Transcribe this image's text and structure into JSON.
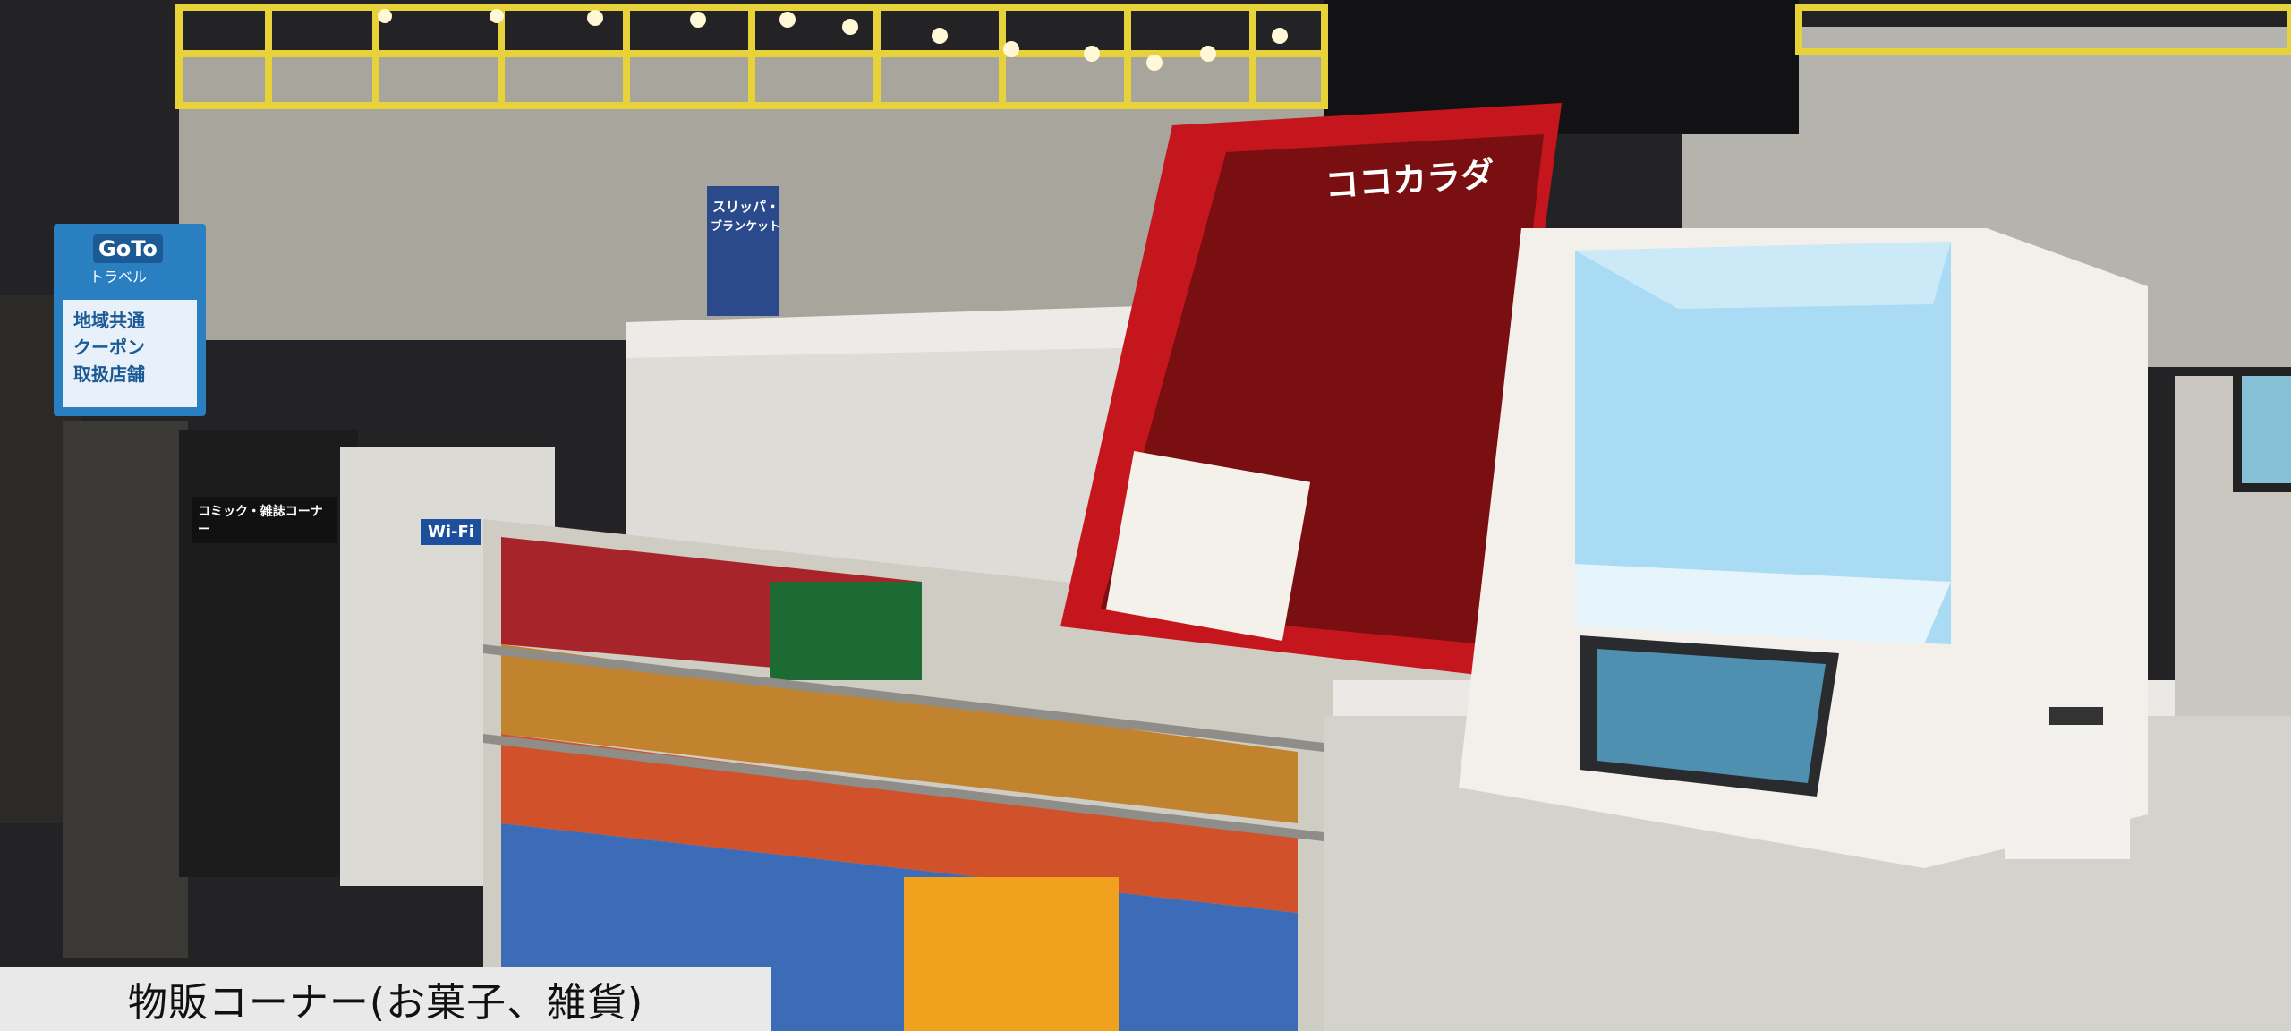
{
  "caption": "物販コーナー(お菓子、雑貨)",
  "signs": {
    "goto_logo": "GoTo",
    "goto_sub": "トラベル",
    "goto_line1": "地域共通",
    "goto_line2": "クーポン",
    "goto_line3": "取扱店舗",
    "slipper_line1": "スリッパ・",
    "slipper_line2": "ブランケット",
    "kokokarada": "ココカラダ",
    "comic_sign": "コミック・雑誌コーナー",
    "wifi": "Wi-Fi"
  },
  "colors": {
    "frame_yellow": "#e8d23a",
    "booth_glow": "#a9dcf4",
    "promo_red": "#c4161c",
    "goto_blue": "#2a7fc1"
  }
}
